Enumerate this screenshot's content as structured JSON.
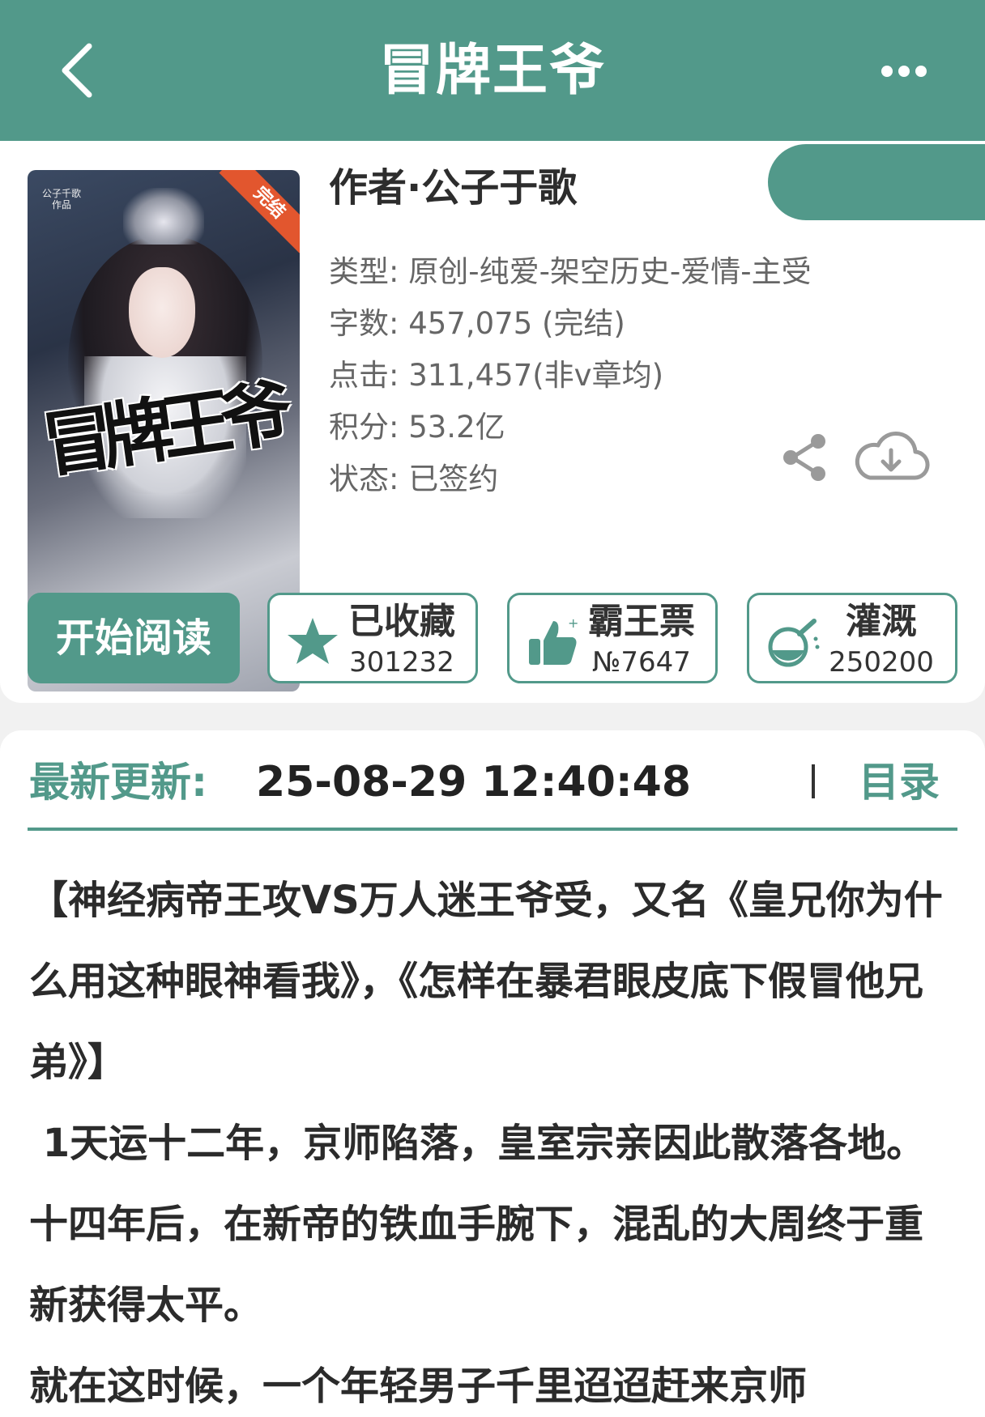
{
  "header": {
    "title": "冒牌王爷",
    "back_icon": "back-arrow-icon",
    "more_icon": "more-dots-icon"
  },
  "book": {
    "cover": {
      "badge": "完结",
      "cover_author": "公子千歌",
      "cover_author_sub": "作品",
      "cover_title": "冒牌王爷"
    },
    "author": "作者·公子于歌",
    "meta": [
      "类型: 原创-纯爱-架空历史-爱情-主受",
      "字数: 457,075 (完结)",
      "点击: 311,457(非v章均)",
      "积分: 53.2亿",
      "状态: 已签约"
    ],
    "share_icon": "share-icon",
    "download_icon": "cloud-download-icon"
  },
  "actions": {
    "start_label": "开始阅读",
    "stats": [
      {
        "label": "已收藏",
        "value": "301232",
        "icon": "star-icon"
      },
      {
        "label": "霸王票",
        "value": "№7647",
        "icon": "thumbs-up-icon"
      },
      {
        "label": "灌溉",
        "value": "250200",
        "icon": "watering-flask-icon"
      }
    ]
  },
  "update": {
    "label": "最新更新:",
    "time": "25-08-29 12:40:48",
    "toc_label": "目录"
  },
  "synopsis": {
    "paragraphs": [
      "【神经病帝王攻VS万人迷王爷受，又名《皇兄你为什么用这种眼神看我》，《怎样在暴君眼皮底下假冒他兄弟》】",
      " 1天运十二年，京师陷落，皇室宗亲因此散落各地。十四年后，在新帝的铁血手腕下，混乱的大周终于重新获得太平。",
      "就在这时候，一个年轻男子千里迢迢赶来京师"
    ]
  },
  "colors": {
    "brand": "#52998a",
    "ribbon": "#e2562e"
  }
}
